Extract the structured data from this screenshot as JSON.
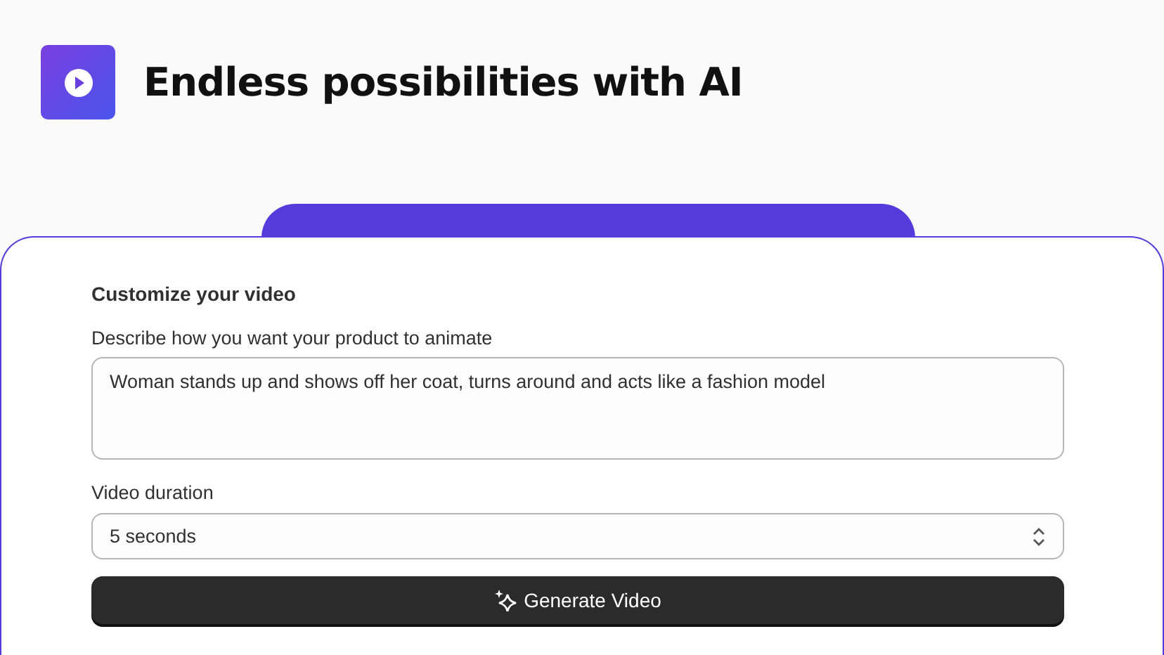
{
  "header": {
    "title": "Endless possibilities with AI"
  },
  "form": {
    "heading": "Customize your video",
    "prompt_label": "Describe how you want your product to animate",
    "prompt_value": "Woman stands up and shows off her coat, turns around and acts like a fashion model",
    "duration_label": "Video duration",
    "duration_value": "5 seconds",
    "button": "Generate Video"
  }
}
